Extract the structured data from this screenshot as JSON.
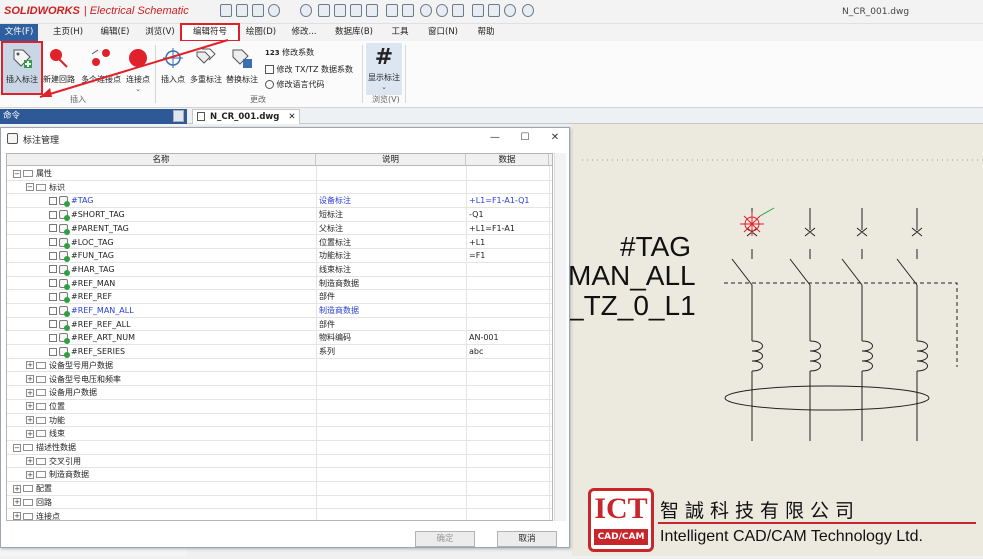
{
  "app": {
    "brand": "SOLIDWORKS",
    "product": "Electrical Schematic",
    "document_title": "N_CR_001.dwg"
  },
  "menu": [
    "文件(F)",
    "主页(H)",
    "编辑(E)",
    "浏览(V)",
    "编辑符号",
    "绘图(D)",
    "修改...",
    "数据库(B)",
    "工具",
    "窗口(N)",
    "帮助"
  ],
  "ribbon": {
    "insert_tag": "插入标注",
    "new_circuit": "新建回路",
    "multi_points": "多个连接点",
    "connect_point": "连接点",
    "insert_point": "插入点",
    "multi_tags": "多重标注",
    "replace_tag": "替换标注",
    "modify_coeff": "修改系数",
    "modify_txtz": "修改 TX/TZ 数据系数",
    "modify_lang": "修改语言代码",
    "show_tag": "显示标注",
    "group_insert": "插入",
    "group_modify": "更改",
    "group_browse": "浏览(V)"
  },
  "command_panel": {
    "title": "命令",
    "pin": "📌"
  },
  "doc_tab": {
    "label": "N_CR_001.dwg",
    "close": "✕"
  },
  "dialog": {
    "title": "标注管理",
    "minimize": "—",
    "maximize": "☐",
    "close": "✕",
    "columns": [
      "名称",
      "说明",
      "数据"
    ],
    "rows": [
      {
        "level": 0,
        "type": "folder",
        "expand": "−",
        "name": "属性",
        "desc": "",
        "data": "",
        "blue": false
      },
      {
        "level": 1,
        "type": "folder",
        "expand": "−",
        "name": "标识",
        "desc": "",
        "data": "",
        "blue": false
      },
      {
        "level": 2,
        "type": "tag",
        "name": "#TAG",
        "desc": "设备标注",
        "data": "+L1=F1-A1-Q1",
        "blue": true
      },
      {
        "level": 2,
        "type": "tag",
        "name": "#SHORT_TAG",
        "desc": "短标注",
        "data": "-Q1",
        "blue": false
      },
      {
        "level": 2,
        "type": "tag",
        "name": "#PARENT_TAG",
        "desc": "父标注",
        "data": "+L1=F1-A1",
        "blue": false
      },
      {
        "level": 2,
        "type": "tag",
        "name": "#LOC_TAG",
        "desc": "位置标注",
        "data": "+L1",
        "blue": false
      },
      {
        "level": 2,
        "type": "tag",
        "name": "#FUN_TAG",
        "desc": "功能标注",
        "data": "=F1",
        "blue": false
      },
      {
        "level": 2,
        "type": "tag",
        "name": "#HAR_TAG",
        "desc": "线束标注",
        "data": "",
        "blue": false
      },
      {
        "level": 2,
        "type": "tag",
        "name": "#REF_MAN",
        "desc": "制造商数据",
        "data": "",
        "blue": false
      },
      {
        "level": 2,
        "type": "tag",
        "name": "#REF_REF",
        "desc": "部件",
        "data": "",
        "blue": false
      },
      {
        "level": 2,
        "type": "tag",
        "name": "#REF_MAN_ALL",
        "desc": "制造商数据",
        "data": "",
        "blue": true
      },
      {
        "level": 2,
        "type": "tag",
        "name": "#REF_REF_ALL",
        "desc": "部件",
        "data": "",
        "blue": false
      },
      {
        "level": 2,
        "type": "tag",
        "name": "#REF_ART_NUM",
        "desc": "物料编码",
        "data": "AN-001",
        "blue": false
      },
      {
        "level": 2,
        "type": "tag",
        "name": "#REF_SERIES",
        "desc": "系列",
        "data": "abc",
        "blue": false
      },
      {
        "level": 1,
        "type": "folder",
        "expand": "+",
        "name": "设备型号用户数据",
        "desc": "",
        "data": "",
        "blue": false
      },
      {
        "level": 1,
        "type": "folder",
        "expand": "+",
        "name": "设备型号电压和频率",
        "desc": "",
        "data": "",
        "blue": false
      },
      {
        "level": 1,
        "type": "folder",
        "expand": "+",
        "name": "设备用户数据",
        "desc": "",
        "data": "",
        "blue": false
      },
      {
        "level": 1,
        "type": "folder",
        "expand": "+",
        "name": "位置",
        "desc": "",
        "data": "",
        "blue": false
      },
      {
        "level": 1,
        "type": "folder",
        "expand": "+",
        "name": "功能",
        "desc": "",
        "data": "",
        "blue": false
      },
      {
        "level": 1,
        "type": "folder",
        "expand": "+",
        "name": "线束",
        "desc": "",
        "data": "",
        "blue": false
      },
      {
        "level": 0,
        "type": "folder",
        "expand": "−",
        "name": "描述性数据",
        "desc": "",
        "data": "",
        "blue": false
      },
      {
        "level": 1,
        "type": "folder",
        "expand": "+",
        "name": "交叉引用",
        "desc": "",
        "data": "",
        "blue": false
      },
      {
        "level": 1,
        "type": "folder",
        "expand": "+",
        "name": "制造商数据",
        "desc": "",
        "data": "",
        "blue": false
      },
      {
        "level": 0,
        "type": "folder",
        "expand": "+",
        "name": "配置",
        "desc": "",
        "data": "",
        "blue": false
      },
      {
        "level": 0,
        "type": "folder",
        "expand": "+",
        "name": "回路",
        "desc": "",
        "data": "",
        "blue": false
      },
      {
        "level": 0,
        "type": "folder",
        "expand": "+",
        "name": "连接点",
        "desc": "",
        "data": "",
        "blue": false
      }
    ],
    "ok": "确定",
    "cancel": "取消"
  },
  "drawing": {
    "texts": [
      "#TAG",
      "MAN_ALL",
      "_TZ_0_L1"
    ]
  },
  "watermark": {
    "logo_top": "ICT",
    "logo_bottom": "CAD/CAM",
    "company_cn": "智誠科技有限公司",
    "company_en": "Intelligent CAD/CAM Technology Ltd."
  },
  "colors": {
    "accent_red": "#e0202a",
    "file_menu": "#2e5f9e",
    "blue_text": "#2b3fd6"
  }
}
